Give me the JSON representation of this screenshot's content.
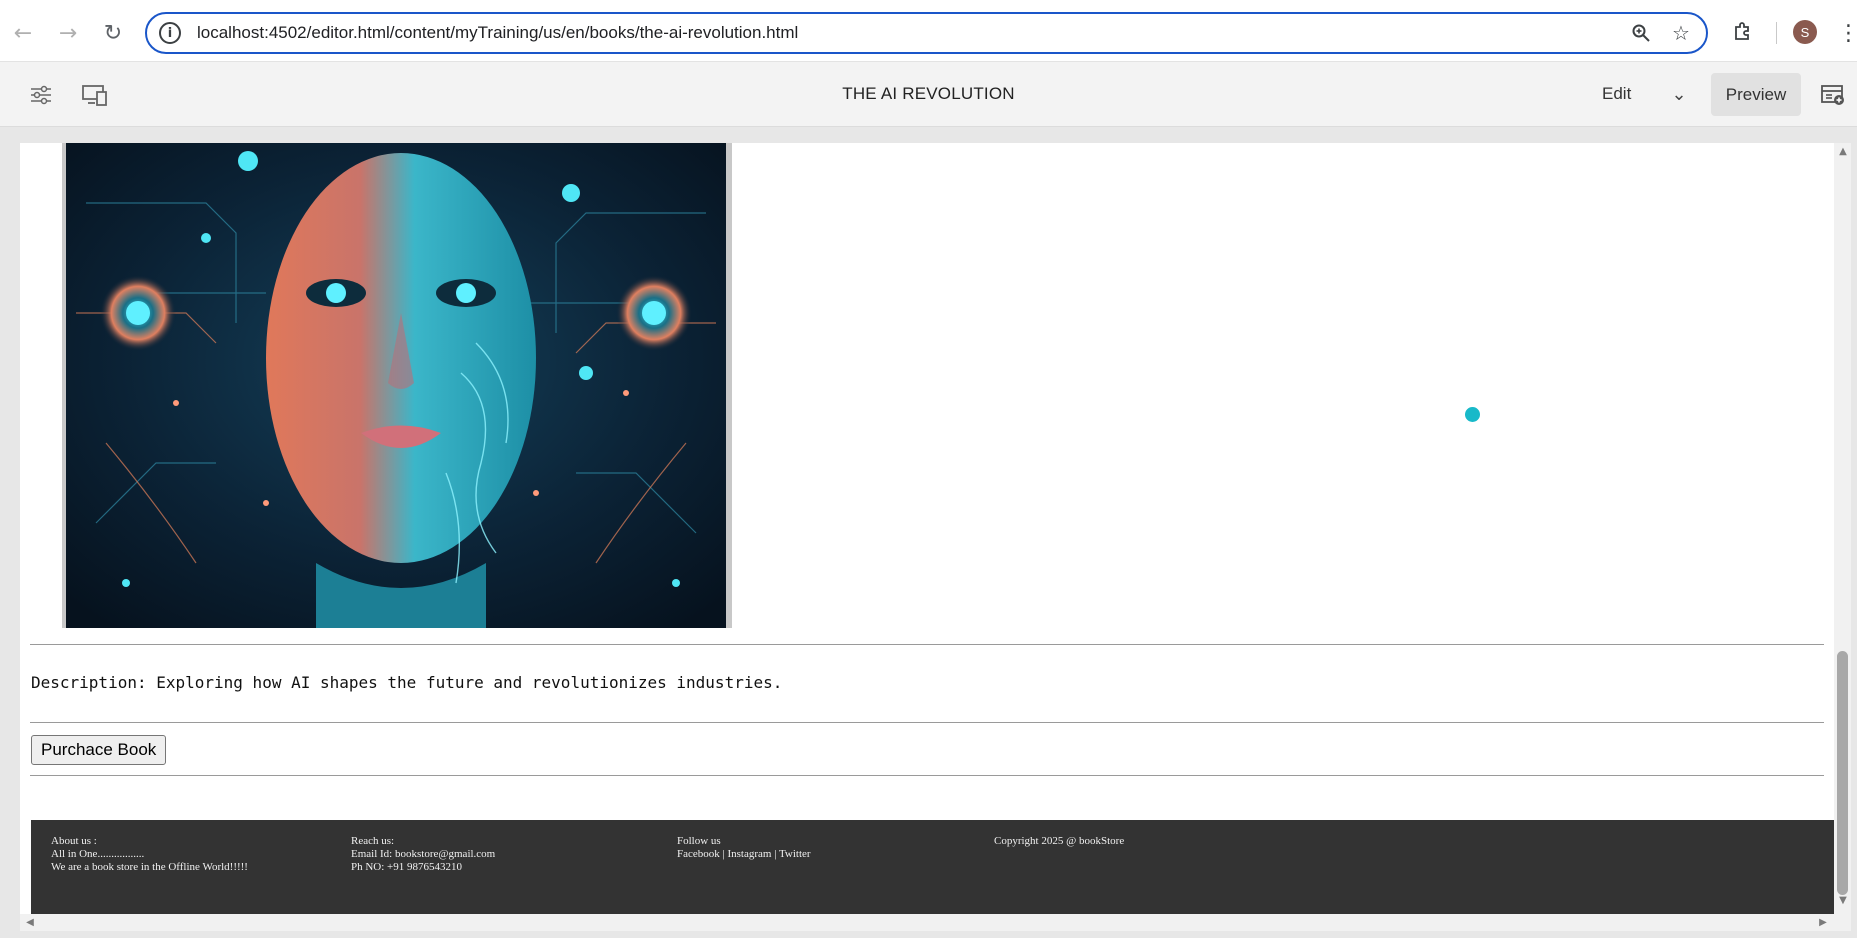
{
  "browser": {
    "url": "localhost:4502/editor.html/content/myTraining/us/en/books/the-ai-revolution.html",
    "avatar_letter": "S"
  },
  "editor": {
    "page_title": "THE AI REVOLUTION",
    "mode_label": "Edit",
    "preview_label": "Preview"
  },
  "content": {
    "description": "Description: Exploring how AI shapes the future and revolutionizes industries.",
    "purchase_button": "Purchace Book"
  },
  "footer": {
    "about": {
      "heading": "About  us :",
      "line1": "All in One.................",
      "line2": "We are a book store in the Offline World!!!!!"
    },
    "reach": {
      "heading": "Reach  us:",
      "email": "Email Id:  bookstore@gmail.com",
      "phone": "Ph NO: +91 9876543210"
    },
    "follow": {
      "heading": "Follow us",
      "links": "Facebook | Instagram | Twitter"
    },
    "copyright": "Copyright 2025 @ bookStore"
  },
  "icons": {
    "back": "arrow-left-icon",
    "forward": "arrow-right-icon",
    "reload": "reload-icon",
    "site_info": "info-icon",
    "zoom": "zoom-icon",
    "bookmark": "star-icon",
    "extensions": "puzzle-icon",
    "menu": "kebab-menu-icon",
    "properties": "sliders-icon",
    "emulator": "devices-icon",
    "side_panel": "side-panel-icon"
  },
  "colors": {
    "accent": "#1a56c9",
    "footer_bg": "#333333",
    "loading_dot": "#18b9c9"
  }
}
